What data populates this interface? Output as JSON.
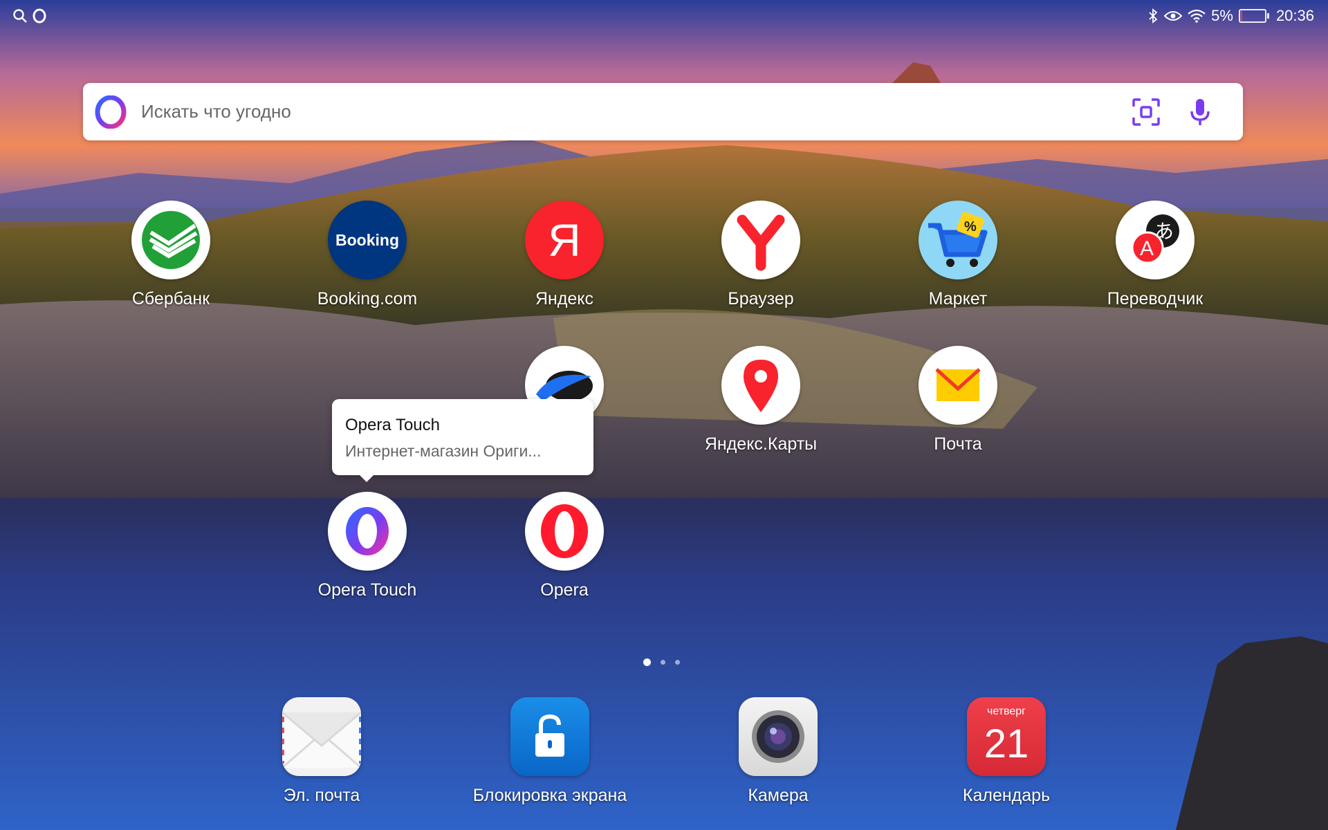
{
  "status_bar": {
    "left_icons": [
      "search-icon",
      "opera-icon"
    ],
    "right_icons": [
      "bluetooth-icon",
      "eye-icon",
      "wifi-icon"
    ],
    "battery_percent": "5%",
    "battery_level": 0.05,
    "time": "20:36"
  },
  "search": {
    "placeholder": "Искать что угодно",
    "icons": [
      "opera-logo-icon",
      "scan-icon",
      "mic-icon"
    ]
  },
  "apps": [
    {
      "label": "Сбербанк",
      "icon": "sberbank-icon"
    },
    {
      "label": "Booking.com",
      "icon": "booking-icon",
      "icon_text": "Booking"
    },
    {
      "label": "Яндекс",
      "icon": "yandex-icon",
      "icon_text": "Я"
    },
    {
      "label": "Браузер",
      "icon": "yandex-browser-icon"
    },
    {
      "label": "Маркет",
      "icon": "market-cart-icon",
      "icon_text": "%"
    },
    {
      "label": "Переводчик",
      "icon": "translate-icon",
      "icon_text": "A",
      "icon_text2": "あ"
    },
    {
      "label": "",
      "icon": "yandex-disk-icon"
    },
    {
      "label": "Яндекс.Карты",
      "icon": "map-pin-icon"
    },
    {
      "label": "Почта",
      "icon": "mail-envelope-icon"
    },
    {
      "label": "Opera Touch",
      "icon": "opera-touch-icon"
    },
    {
      "label": "Opera",
      "icon": "opera-icon"
    }
  ],
  "tooltip": {
    "title": "Opera Touch",
    "subtitle": "Интернет-магазин Ориги..."
  },
  "page_indicator": {
    "pages": 3,
    "active": 1
  },
  "dock": [
    {
      "label": "Эл. почта",
      "icon": "email-icon"
    },
    {
      "label": "Блокировка экрана",
      "icon": "lock-icon"
    },
    {
      "label": "Камера",
      "icon": "camera-icon"
    },
    {
      "label": "Календарь",
      "icon": "calendar-icon",
      "weekday": "четверг",
      "day": "21"
    }
  ],
  "colors": {
    "accent_opera": "#ff1b2d",
    "opera_touch": "#6a3cf0",
    "sber_green": "#21a038",
    "booking_blue": "#003580"
  }
}
